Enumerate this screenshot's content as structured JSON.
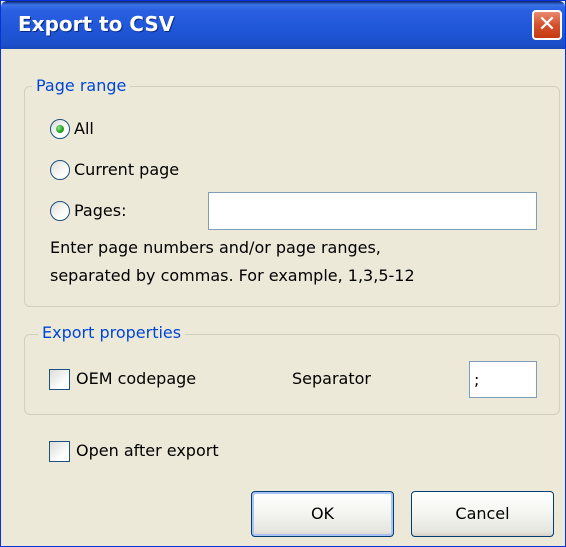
{
  "window": {
    "title": "Export to CSV",
    "close_glyph": "✕"
  },
  "page_range": {
    "title": "Page range",
    "options": [
      {
        "label": "All",
        "selected": true
      },
      {
        "label": "Current page",
        "selected": false
      },
      {
        "label": "Pages:",
        "selected": false
      }
    ],
    "pages_input": {
      "value": "",
      "placeholder": ""
    },
    "hint_lines": [
      "Enter page numbers and/or page ranges,",
      "separated by commas. For example, 1,3,5-12"
    ]
  },
  "export_properties": {
    "title": "Export properties",
    "oem_codepage": {
      "label": "OEM codepage",
      "checked": false
    },
    "separator": {
      "label": "Separator",
      "value": ";"
    }
  },
  "open_after_export": {
    "label": "Open after export",
    "checked": false
  },
  "buttons": {
    "ok": "OK",
    "cancel": "Cancel"
  },
  "colors": {
    "group_title": "#0046d5",
    "dialog_bg": "#ece9d8",
    "titlebar": "#1f56d8"
  },
  "icons": {
    "close": "close-icon",
    "radio_selected": "radio-dot-icon"
  }
}
